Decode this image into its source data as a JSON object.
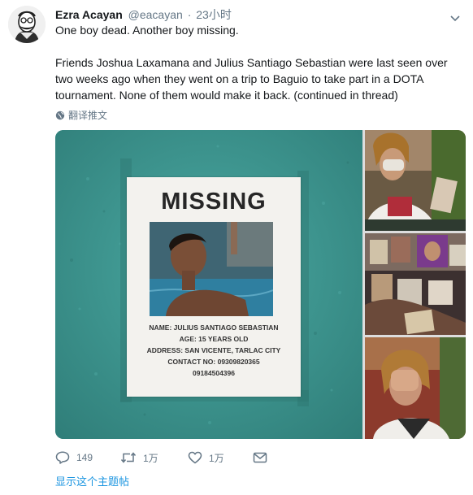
{
  "tweet": {
    "author_name": "Ezra Acayan",
    "handle": "@eacayan",
    "separator": "·",
    "time": "23小时",
    "text_line1": "One boy dead. Another boy missing.",
    "text_para2": "Friends Joshua Laxamana and Julius Santiago Sebastian were last seen over two weeks ago when they went on a trip to Baguio to take part in a DOTA tournament. None of them would make it back. (continued in thread)",
    "translate_label": "翻译推文"
  },
  "poster": {
    "title": "MISSING",
    "name_line": "NAME: JULIUS SANTIAGO SEBASTIAN",
    "age_line": "AGE: 15 YEARS OLD",
    "address_line": "ADDRESS: SAN VICENTE, TARLAC CITY",
    "contact_line": "CONTACT NO: 09309820365",
    "contact_line2": "09184504396"
  },
  "actions": {
    "reply_count": "149",
    "retweet_count": "1万",
    "like_count": "1万"
  },
  "footer": {
    "show_thread": "显示这个主题帖"
  },
  "icons": [
    "avatar",
    "caret-down-icon",
    "globe-icon",
    "reply-icon",
    "retweet-icon",
    "heart-icon",
    "mail-icon"
  ],
  "colors": {
    "name": "#14171a",
    "secondary": "#657786",
    "link": "#1b95e0",
    "wall": "#3e9a93"
  }
}
